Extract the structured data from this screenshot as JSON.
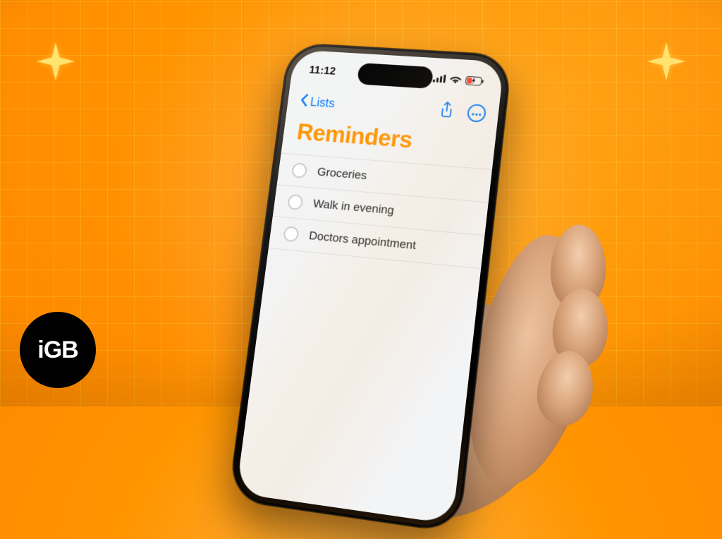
{
  "status_bar": {
    "time": "11:12"
  },
  "nav": {
    "back_label": "Lists"
  },
  "page": {
    "title": "Reminders"
  },
  "reminders": [
    {
      "label": "Groceries"
    },
    {
      "label": "Walk in evening"
    },
    {
      "label": "Doctors appointment"
    }
  ],
  "badge": {
    "text": "iGB"
  }
}
